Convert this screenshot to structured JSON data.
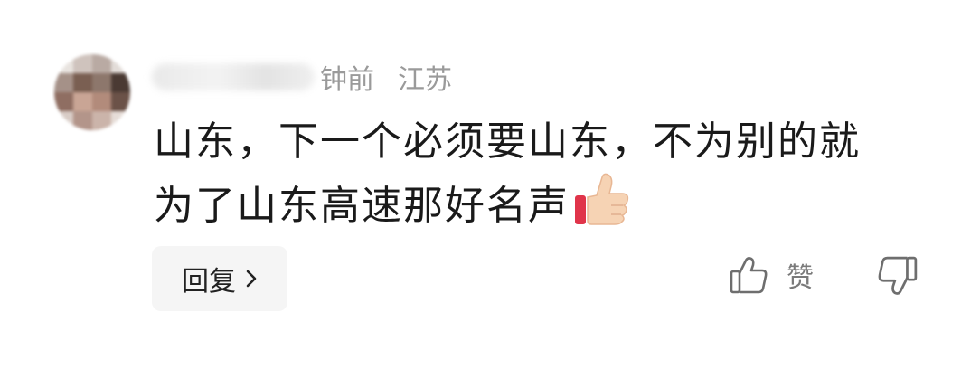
{
  "comment": {
    "meta": {
      "time": "钟前",
      "location": "江苏"
    },
    "text_line1": "山东，下一个必须要山东，不为别的就",
    "text_line2": "为了山东高速那好名声",
    "emoji": "thumbs-up-icon",
    "reply_label": "回复",
    "like_label": "赞"
  }
}
